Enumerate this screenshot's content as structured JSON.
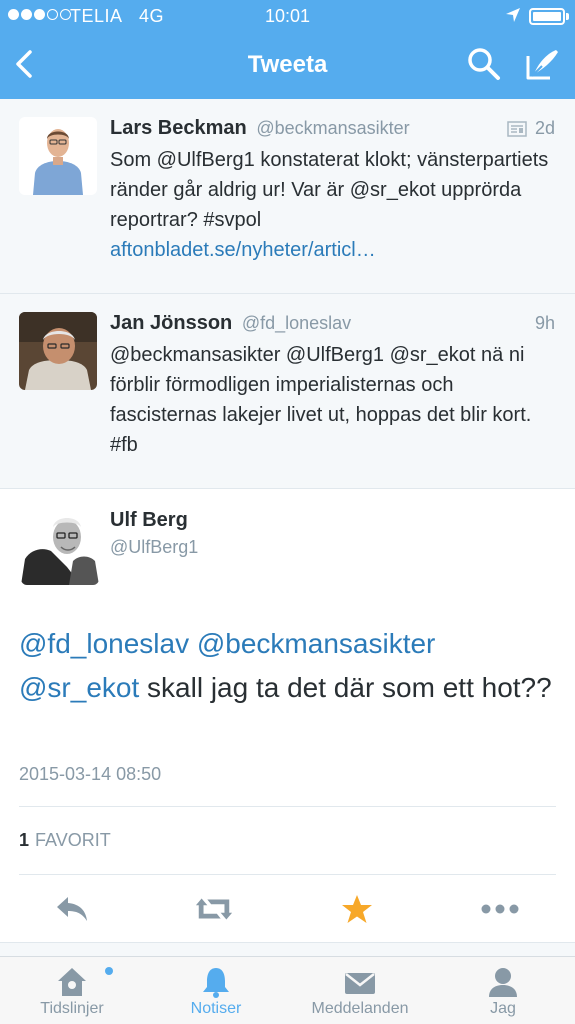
{
  "status_bar": {
    "carrier": "TELIA",
    "network": "4G",
    "time": "10:01",
    "signal_dots_filled": 3,
    "signal_dots_total": 5
  },
  "nav": {
    "title": "Tweeta"
  },
  "colors": {
    "brand": "#55acee",
    "link": "#2b7bb9",
    "favorite": "#f7a829",
    "muted": "#8899a6"
  },
  "context_tweets": [
    {
      "name": "Lars Beckman",
      "handle": "@beckmansasikter",
      "time": "2d",
      "text": "Som @UlfBerg1 konstaterat klokt; vänsterpartiets ränder går aldrig ur! Var är @sr_ekot upprörda reportrar? #svpol",
      "link": "aftonbladet.se/nyheter/articl…"
    },
    {
      "name": "Jan Jönsson",
      "handle": "@fd_loneslav",
      "time": "9h",
      "text": "@beckmansasikter @UlfBerg1 @sr_ekot nä ni förblir förmodligen imperialisternas och fascisternas lakejer livet ut, hoppas det blir kort. #fb"
    }
  ],
  "main_tweet": {
    "name": "Ulf Berg",
    "handle": "@UlfBerg1",
    "mention1": "@fd_loneslav",
    "mention2": "@beckmansasikter",
    "mention3": "@sr_ekot",
    "text_rest": " skall jag ta det där som ett hot??",
    "date": "2015-03-14 08:50",
    "fav_count": "1",
    "fav_label": "FAVORIT"
  },
  "tabs": [
    {
      "label": "Tidslinjer",
      "icon": "home-icon"
    },
    {
      "label": "Notiser",
      "icon": "bell-icon"
    },
    {
      "label": "Meddelanden",
      "icon": "envelope-icon"
    },
    {
      "label": "Jag",
      "icon": "person-icon"
    }
  ]
}
